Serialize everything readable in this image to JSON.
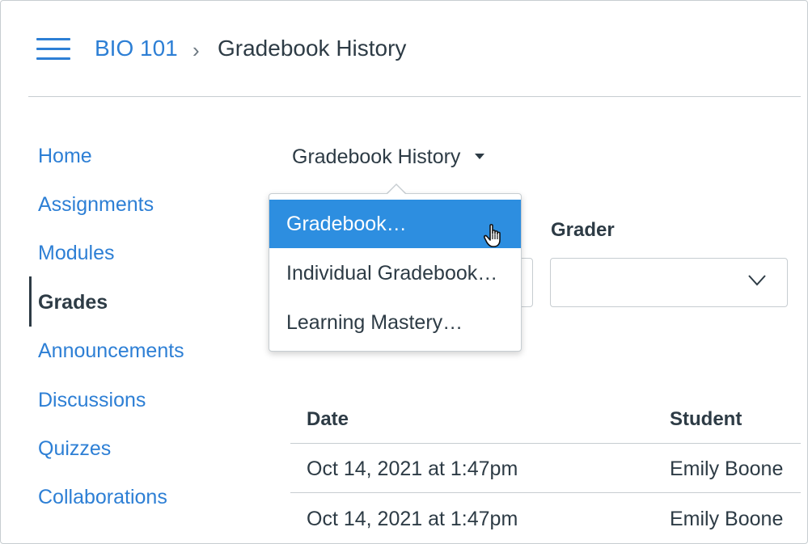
{
  "header": {
    "course": "BIO 101",
    "separator": "›",
    "current": "Gradebook History"
  },
  "nav": {
    "items": [
      {
        "label": "Home",
        "active": false
      },
      {
        "label": "Assignments",
        "active": false
      },
      {
        "label": "Modules",
        "active": false
      },
      {
        "label": "Grades",
        "active": true
      },
      {
        "label": "Announcements",
        "active": false
      },
      {
        "label": "Discussions",
        "active": false
      },
      {
        "label": "Quizzes",
        "active": false
      },
      {
        "label": "Collaborations",
        "active": false
      }
    ]
  },
  "main": {
    "view_toggle_label": "Gradebook History",
    "grader_label": "Grader",
    "grader_value": "",
    "menu": {
      "items": [
        "Gradebook…",
        "Individual Gradebook…",
        "Learning Mastery…"
      ],
      "highlighted_index": 0
    },
    "table": {
      "columns": [
        "Date",
        "Student"
      ],
      "rows": [
        [
          "Oct 14, 2021 at 1:47pm",
          "Emily Boone"
        ],
        [
          "Oct 14, 2021 at 1:47pm",
          "Emily Boone"
        ]
      ]
    }
  },
  "colors": {
    "link": "#2d7fd5",
    "text": "#2d3b45",
    "highlight": "#2d8ee0",
    "border": "#c7cdd1"
  }
}
